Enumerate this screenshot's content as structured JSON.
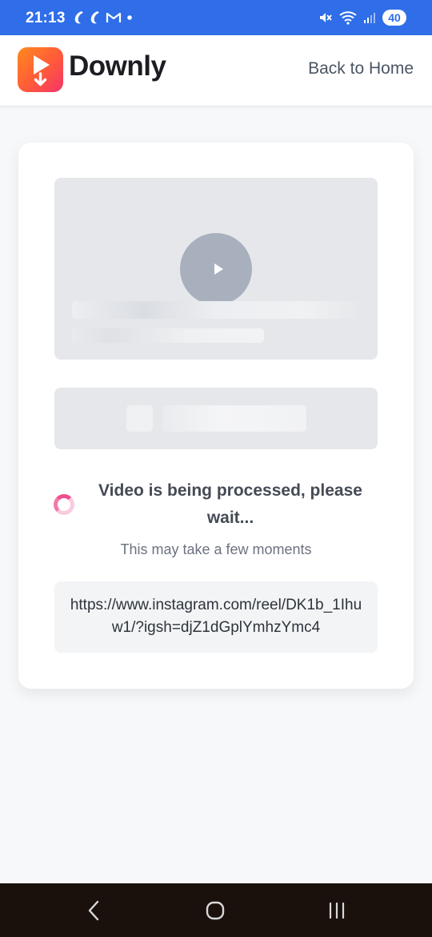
{
  "status_bar": {
    "time": "21:13",
    "left_icons": [
      "notification-app-icon",
      "notification-app-icon",
      "gmail-icon",
      "dot-icon"
    ],
    "right_icons": [
      "mute-icon",
      "wifi-icon",
      "signal-icon"
    ],
    "battery": "40",
    "color": "#2f6ee8"
  },
  "header": {
    "brand": "Downly",
    "back_link": "Back to Home",
    "logo_icon": "play-download-icon"
  },
  "processing": {
    "title": "Video is being processed, please wait...",
    "subtitle": "This may take a few moments",
    "url": "https://www.instagram.com/reel/DK1b_1Ihuw1/?igsh=djZ1dGplYmhzYmc4",
    "spinner_color": "#ef4e8e"
  },
  "nav_bar": {
    "back_icon": "back-chevron-icon",
    "home_icon": "home-circle-icon",
    "recents_icon": "recents-lines-icon"
  }
}
